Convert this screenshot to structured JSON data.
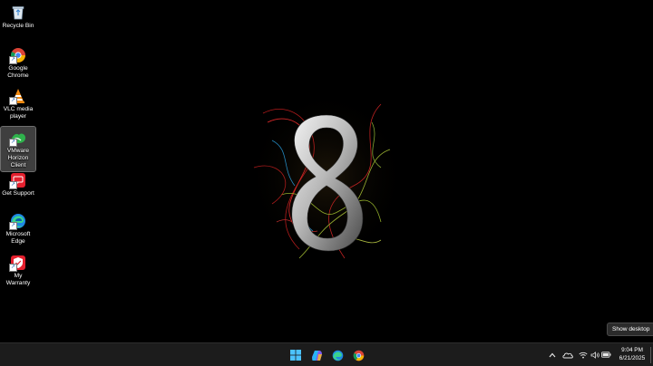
{
  "desktop": {
    "icons": [
      {
        "label": "Recycle Bin",
        "icon": "recycle-bin-icon"
      },
      {
        "label": "Google Chrome",
        "icon": "chrome-icon"
      },
      {
        "label": "VLC media player",
        "icon": "vlc-icon"
      },
      {
        "label": "VMware Horizon Client",
        "icon": "vmware-horizon-icon",
        "selected": true
      },
      {
        "label": "Get Support",
        "icon": "get-support-icon"
      },
      {
        "label": "Microsoft Edge",
        "icon": "edge-icon"
      },
      {
        "label": "My Warranty",
        "icon": "my-warranty-icon"
      }
    ],
    "wallpaper": "numeral-8-wallpaper"
  },
  "tooltip": {
    "show_desktop": "Show desktop"
  },
  "taskbar": {
    "apps": [
      "windows-start-icon",
      "copilot-icon",
      "edge-icon",
      "chrome-icon"
    ],
    "tray": [
      "chevron-up-icon",
      "onedrive-icon",
      "wifi-icon",
      "volume-icon",
      "battery-icon"
    ],
    "time": "9:04 PM",
    "date": "6/21/2025"
  },
  "colors": {
    "taskbar_bg": "#1c1c1c",
    "desktop_bg": "#000000",
    "accent": "#1e88e5"
  }
}
